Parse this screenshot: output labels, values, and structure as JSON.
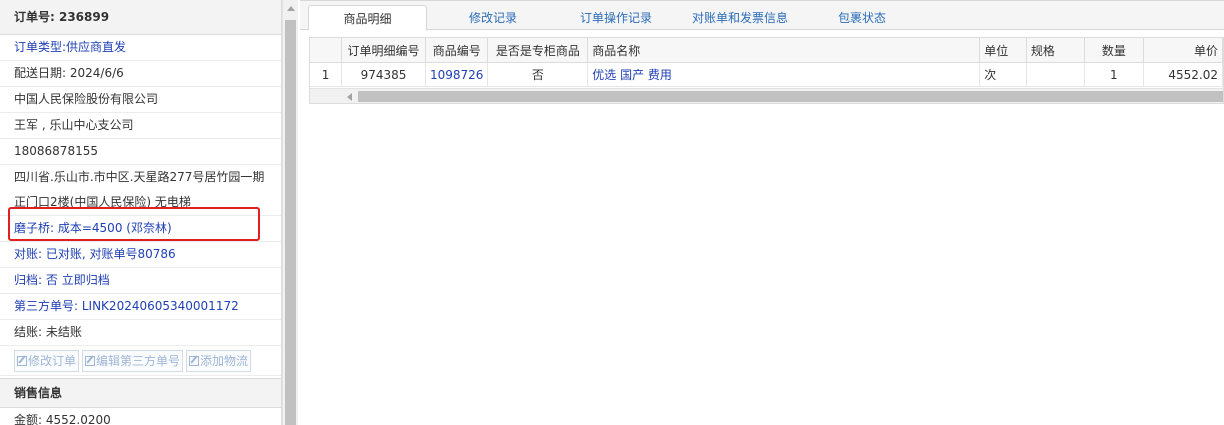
{
  "left": {
    "order_label": "订单号: 236899",
    "order_type": "订单类型:供应商直发",
    "delivery_date": "配送日期: 2024/6/6",
    "company": "中国人民保险股份有限公司",
    "contact": "王军 , 乐山中心支公司",
    "phone": "18086878155",
    "address_line1": "四川省.乐山市.市中区.天星路277号居竹园一期",
    "address_line2": "正门口2楼(中国人民保险) 无电梯",
    "cost_note": "磨子桥: 成本=4500 (邓奈林)",
    "reconcile": "对账: 已对账, 对账单号80786",
    "archive_prefix": "归档: 否",
    "archive_link": "立即归档",
    "third_party_no": "第三方单号: LINK20240605340001172",
    "settlement": "结账: 未结账",
    "buttons": {
      "edit_order": "修改订单",
      "edit_third_party": "编辑第三方单号",
      "add_logistics": "添加物流"
    },
    "sales_section": "销售信息",
    "amount": "金额: 4552.0200"
  },
  "tabs": [
    "商品明细",
    "修改记录",
    "订单操作记录",
    "对账单和发票信息",
    "包裹状态"
  ],
  "grid": {
    "headers": [
      "",
      "订单明细编号",
      "商品编号",
      "是否是专柜商品",
      "商品名称",
      "单位",
      "规格",
      "数量",
      "单价"
    ],
    "rows": [
      [
        "1",
        "974385",
        "1098726",
        "否",
        "优选 国产 费用",
        "次",
        "",
        "1",
        "4552.02"
      ]
    ]
  },
  "colors": {
    "link_blue": "#1f3fb4",
    "tab_blue": "#2b6cb8",
    "highlight_red": "#e02020"
  }
}
